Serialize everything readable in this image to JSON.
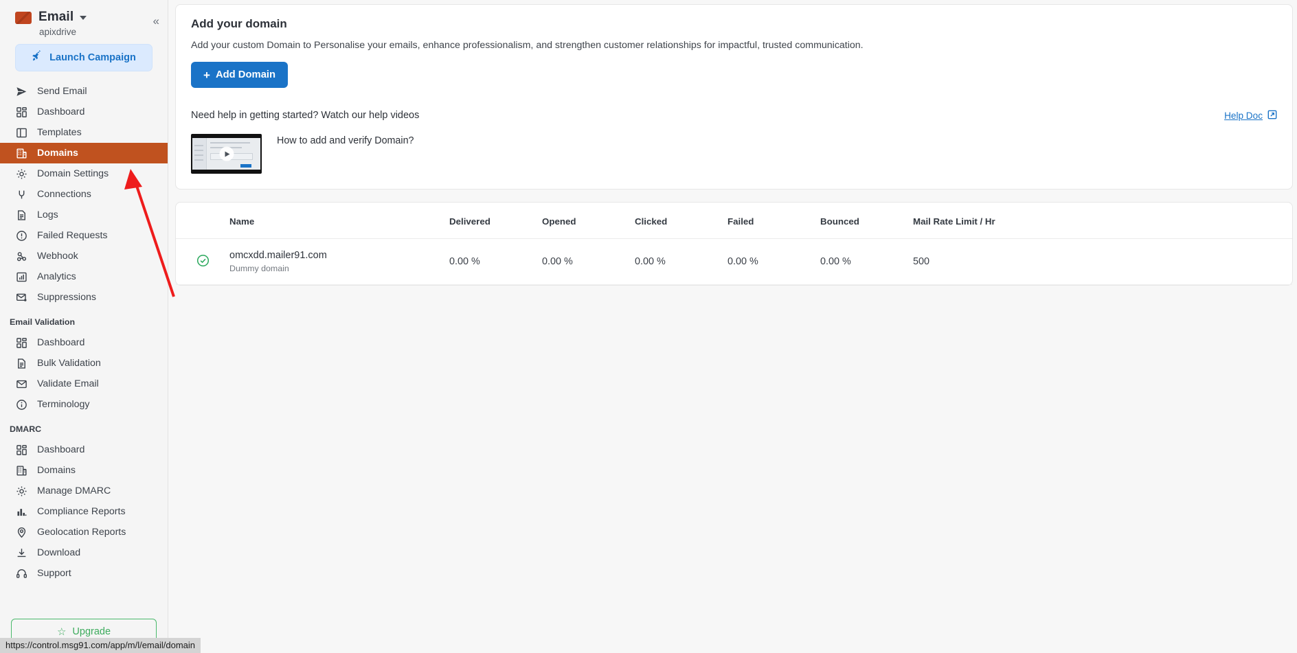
{
  "sidebar": {
    "brand": {
      "title": "Email",
      "subtitle": "apixdrive",
      "mail_icon": "mail-icon",
      "chevron": "chevron-down-icon"
    },
    "collapse_icon": "collapse-sidebar-icon",
    "collapse_glyph": "«",
    "launch_button": {
      "label": "Launch Campaign",
      "icon": "rocket-icon",
      "glyph": "🚀"
    },
    "groups": [
      {
        "title": "",
        "items": [
          {
            "label": "Send Email",
            "icon": "send-icon",
            "active": false
          },
          {
            "label": "Dashboard",
            "icon": "dashboard-icon",
            "active": false
          },
          {
            "label": "Templates",
            "icon": "templates-icon",
            "active": false
          },
          {
            "label": "Domains",
            "icon": "building-icon",
            "active": true
          },
          {
            "label": "Domain Settings",
            "icon": "gear-icon",
            "active": false
          },
          {
            "label": "Connections",
            "icon": "plug-icon",
            "active": false
          },
          {
            "label": "Logs",
            "icon": "document-icon",
            "active": false
          },
          {
            "label": "Failed Requests",
            "icon": "alert-circle-icon",
            "active": false
          },
          {
            "label": "Webhook",
            "icon": "webhook-icon",
            "active": false
          },
          {
            "label": "Analytics",
            "icon": "analytics-icon",
            "active": false
          },
          {
            "label": "Suppressions",
            "icon": "mail-block-icon",
            "active": false
          }
        ]
      },
      {
        "title": "Email Validation",
        "items": [
          {
            "label": "Dashboard",
            "icon": "dashboard-icon",
            "active": false
          },
          {
            "label": "Bulk Validation",
            "icon": "document-icon",
            "active": false
          },
          {
            "label": "Validate Email",
            "icon": "envelope-icon",
            "active": false
          },
          {
            "label": "Terminology",
            "icon": "info-circle-icon",
            "active": false
          }
        ]
      },
      {
        "title": "DMARC",
        "items": [
          {
            "label": "Dashboard",
            "icon": "dashboard-icon",
            "active": false
          },
          {
            "label": "Domains",
            "icon": "building-icon",
            "active": false
          },
          {
            "label": "Manage DMARC",
            "icon": "gear-icon",
            "active": false
          },
          {
            "label": "Compliance Reports",
            "icon": "bar-chart-icon",
            "active": false
          },
          {
            "label": "Geolocation Reports",
            "icon": "map-pin-icon",
            "active": false
          },
          {
            "label": "Download",
            "icon": "download-icon",
            "active": false
          },
          {
            "label": "Support",
            "icon": "headset-icon",
            "active": false
          }
        ]
      }
    ],
    "upgrade_button": {
      "label": "Upgrade",
      "icon": "star-icon",
      "glyph": "☆"
    }
  },
  "main": {
    "heading": "Add your domain",
    "description": "Add your custom Domain to Personalise your emails, enhance professionalism, and strengthen customer relationships for impactful, trusted communication.",
    "add_domain_button": {
      "label": "Add Domain",
      "plus": "+",
      "icon": "plus-icon"
    },
    "help": {
      "title": "Need help in getting started? Watch our help videos",
      "doc_link": {
        "label": "Help Doc",
        "icon": "external-link-icon"
      },
      "video": {
        "title": "How to add and verify Domain?",
        "play_icon": "play-icon"
      }
    },
    "table": {
      "columns": [
        "",
        "Name",
        "Delivered",
        "Opened",
        "Clicked",
        "Failed",
        "Bounced",
        "Mail Rate Limit / Hr"
      ],
      "rows": [
        {
          "status_icon": "verified-check-icon",
          "name": "omcxdd.mailer91.com",
          "sub": "Dummy domain",
          "delivered": "0.00 %",
          "opened": "0.00 %",
          "clicked": "0.00 %",
          "failed": "0.00 %",
          "bounced": "0.00 %",
          "mail_rate_limit": "500"
        }
      ]
    }
  },
  "status_bar": {
    "url": "https://control.msg91.com/app/m/l/email/domain"
  },
  "annotation": {
    "type": "red-arrow",
    "points_to": "Domains",
    "color": "#ee1c1c"
  },
  "colors": {
    "accent_blue": "#1a73c7",
    "active_nav": "#c0521f",
    "upgrade_green": "#3dab5d",
    "status_green": "#2aa85c"
  }
}
